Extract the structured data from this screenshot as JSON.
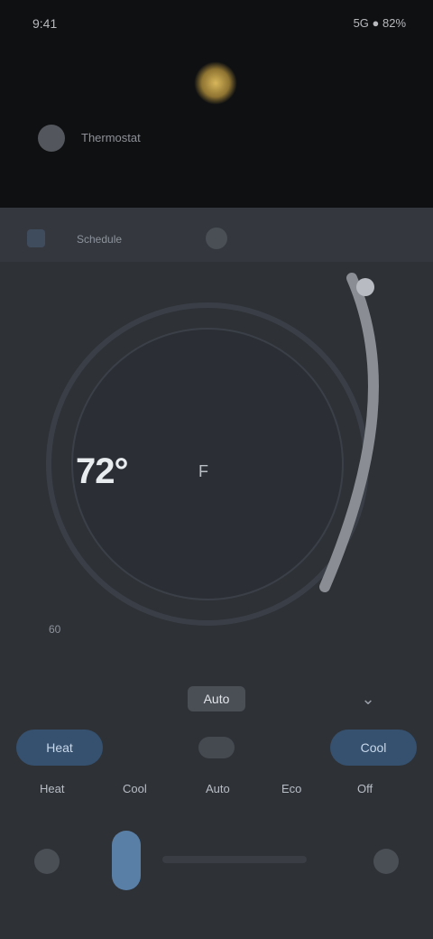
{
  "status": {
    "time": "9:41",
    "right_text": "5G ● 82%"
  },
  "notification": {
    "text": "Thermostat"
  },
  "mode_strip": {
    "label": "Schedule"
  },
  "thermostat": {
    "temperature": "72°",
    "unit": "F",
    "side_label": "60"
  },
  "controls": {
    "center_value": "Auto",
    "left_button": "Heat",
    "right_button": "Cool"
  },
  "modes": [
    {
      "label": "Heat"
    },
    {
      "label": "Cool"
    },
    {
      "label": "Auto"
    },
    {
      "label": "Eco"
    },
    {
      "label": "Off"
    }
  ],
  "bottom": {
    "left_icon": "leaf-icon",
    "right_icon": "settings-icon"
  },
  "colors": {
    "background": "#2e3136",
    "topbar": "#0f1012",
    "accent": "#5a7fa6",
    "sun": "#d7b65a"
  }
}
